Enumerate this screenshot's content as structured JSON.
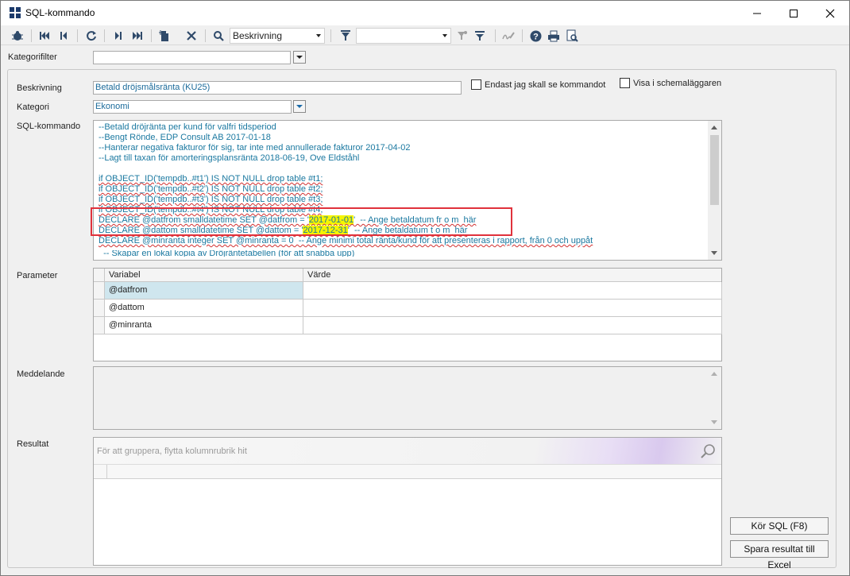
{
  "window": {
    "title": "SQL-kommando",
    "minimize_glyph": "—",
    "maximize_glyph": "☐",
    "close_glyph": "✕"
  },
  "toolbar": {
    "search_field_combo": "Beskrivning",
    "filter_combo": "",
    "icons": [
      "bug-icon",
      "first-record-icon",
      "previous-record-icon",
      "refresh-icon",
      "next-record-icon",
      "last-record-icon",
      "new-document-icon",
      "delete-icon",
      "search-icon",
      "filter-icon",
      "filter-clear-icon",
      "filter-options-icon",
      "sign-icon",
      "help-icon",
      "print-icon",
      "print-preview-icon"
    ]
  },
  "category_filter": {
    "label": "Kategorifilter",
    "value": ""
  },
  "form": {
    "description_label": "Beskrivning",
    "description_value": "Betald dröjsmålsränta (KU25)",
    "only_me_label": "Endast jag skall se kommandot",
    "show_in_scheduler_label": "Visa i schemaläggaren",
    "category_label": "Kategori",
    "category_value": "Ekonomi",
    "sql_label": "SQL-kommando",
    "sql_lines": [
      "--Betald dröjränta per kund för valfri tidsperiod",
      "--Bengt Rönde, EDP Consult AB 2017-01-18",
      "--Hanterar negativa fakturor för sig, tar inte med annullerade fakturor 2017-04-02",
      "--Lagt till taxan för amorteringsplansränta 2018-06-19, Ove Eldståhl",
      "",
      "if OBJECT_ID('tempdb..#t1') IS NOT NULL drop table #t1;",
      "if OBJECT_ID('tempdb..#t2') IS NOT NULL drop table #t2;",
      "if OBJECT_ID('tempdb..#t3') IS NOT NULL drop table #t3;",
      "if OBJECT_ID('tempdb..#t4') IS NOT NULL drop table #t4;"
    ],
    "sql_declare_from_pre": "DECLARE @datfrom smalldatetime SET @datfrom = '",
    "sql_declare_from_val": "2017-01-01",
    "sql_declare_from_post": "'  -- Ange betaldatum fr o m  här",
    "sql_declare_tom_pre": "DECLARE @dattom smalldatetime SET @dattom = '",
    "sql_declare_tom_val": "2017-12-31",
    "sql_declare_tom_post": "'  -- Ange betaldatum t o m  här",
    "sql_line_minranta": "DECLARE @minranta integer SET @minranta = 0  -- Ange minimi total ränta/kund för att presenteras i rapport, från 0 och uppåt",
    "sql_line_cut": "  -- Skapar en lokal kopia av Dröjräntetabellen (för att snabba upp)"
  },
  "parameters": {
    "label": "Parameter",
    "columns": [
      "Variabel",
      "Värde"
    ],
    "rows": [
      {
        "variable": "@datfrom",
        "value": ""
      },
      {
        "variable": "@dattom",
        "value": ""
      },
      {
        "variable": "@minranta",
        "value": ""
      }
    ]
  },
  "message": {
    "label": "Meddelande",
    "value": ""
  },
  "result": {
    "label": "Resultat",
    "group_hint": "För att gruppera, flytta kolumnrubrik hit"
  },
  "buttons": {
    "run_sql": "Kör SQL (F8)",
    "save_excel": "Spara resultat till Excel"
  }
}
